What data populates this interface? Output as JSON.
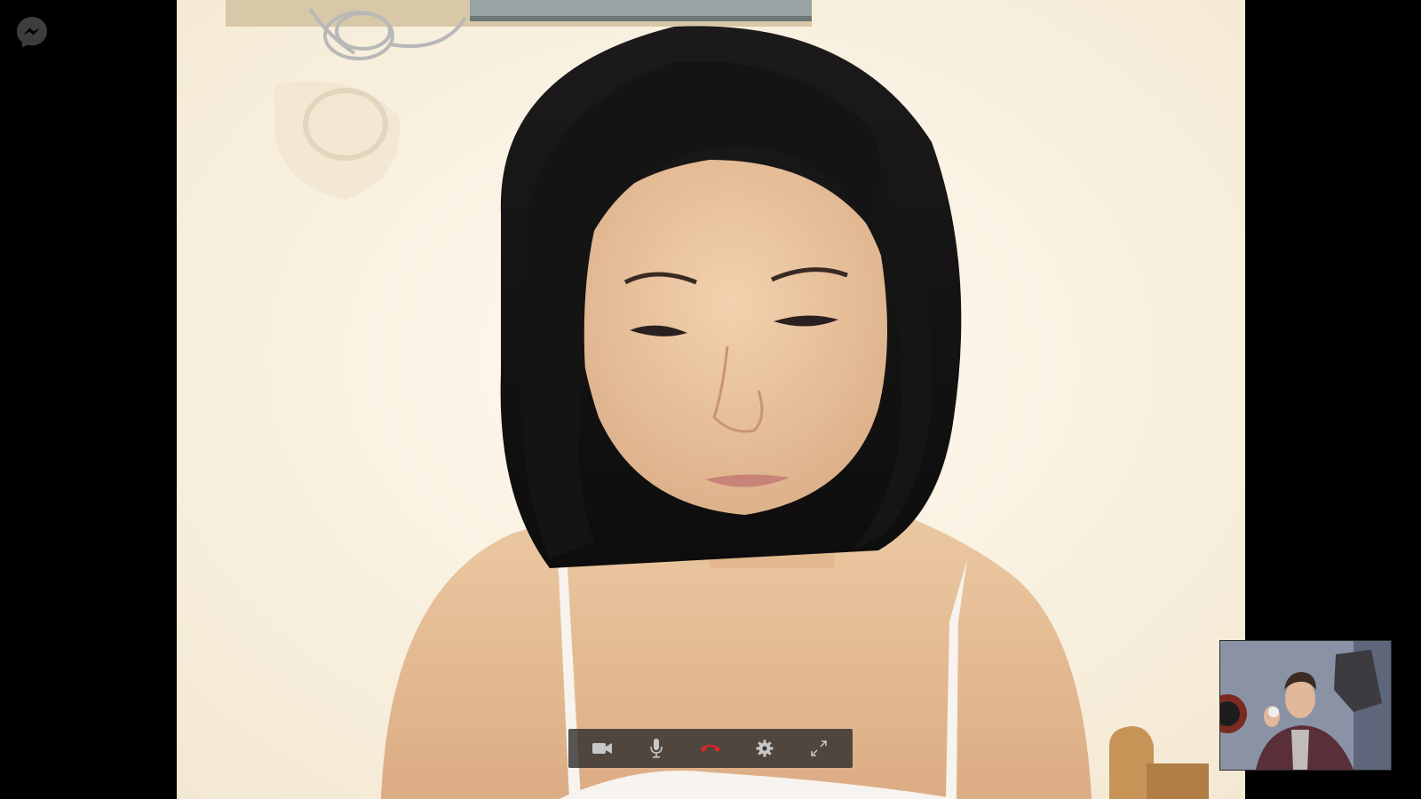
{
  "app": {
    "name": "Messenger",
    "logo_icon": "messenger-logo-icon"
  },
  "remote_participant": {
    "video": "remote-video-feed"
  },
  "self_view": {
    "video": "self-video-feed"
  },
  "controls": [
    {
      "id": "video",
      "icon": "video-camera-icon"
    },
    {
      "id": "mic",
      "icon": "microphone-icon"
    },
    {
      "id": "end_call",
      "icon": "end-call-icon",
      "color": "#e0262b"
    },
    {
      "id": "settings",
      "icon": "gear-icon"
    },
    {
      "id": "fullscreen",
      "icon": "fullscreen-expand-icon"
    }
  ],
  "colors": {
    "background": "#000000",
    "control_bar": "#3a3a3a",
    "icon": "#c8c8c8",
    "end_call": "#e0262b",
    "wall": "#fbf3e3"
  }
}
